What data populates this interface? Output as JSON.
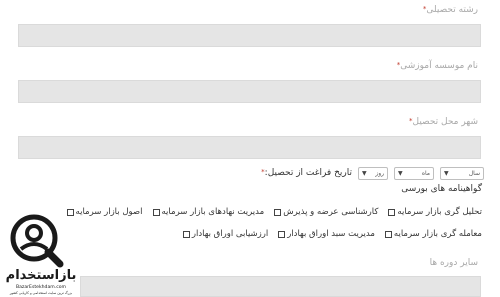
{
  "fields": [
    {
      "label": "رشته تحصیلی",
      "required": "*"
    },
    {
      "label": "نام موسسه آموزشی",
      "required": "*"
    },
    {
      "label": "شهر محل تحصیل",
      "required": "*"
    }
  ],
  "graduation": {
    "label": "تاریخ فراغت از تحصیل:",
    "required": "*",
    "day": "روز",
    "month": "ماه",
    "year": "سال"
  },
  "certificates": {
    "title": "گواهینامه های بورسی",
    "row1": [
      "اصول بازار سرمایه",
      "مدیریت نهادهای بازار سرمایه",
      "کارشناسی عرضه و پذیرش",
      "تحلیل گری بازار سرمایه"
    ],
    "row2": [
      "ارزشیابی اوراق بهادار",
      "مدیریت سبد اوراق بهادار",
      "معامله گری بازار سرمایه"
    ]
  },
  "other_courses": {
    "label": "سایر دوره ها"
  },
  "logo": {
    "brand": "بازاستخدام",
    "url": "BazarEstekhdam.com",
    "tagline": "بزرگ ترین سایت استخدامی و کاریابی کشور"
  }
}
